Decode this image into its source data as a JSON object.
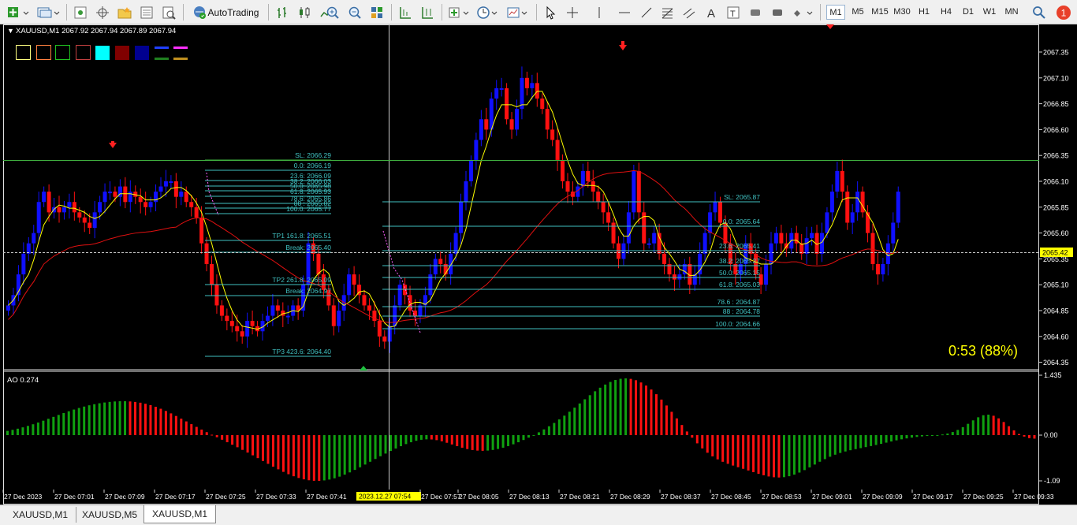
{
  "toolbar": {
    "autotrading_label": "AutoTrading",
    "timeframes": [
      "M1",
      "M5",
      "M15",
      "M30",
      "H1",
      "H4",
      "D1",
      "W1",
      "MN"
    ],
    "active_timeframe": "M1",
    "notification_count": "1"
  },
  "chart": {
    "header": "XAUUSD,M1  2067.92 2067.94 2067.89 2067.94",
    "current_price": "2065.42",
    "timer_text": "0:53 (88%)",
    "indicator_label": "AO 0.274",
    "ao_axis": [
      "1.435",
      "0.00",
      "-1.09"
    ],
    "price_ticks": [
      "2067.35",
      "2067.10",
      "2066.85",
      "2066.60",
      "2066.35",
      "2066.10",
      "2065.85",
      "2065.60",
      "2065.35",
      "2065.10",
      "2064.85",
      "2064.60",
      "2064.35"
    ],
    "time_labels": [
      "27 Dec 2023",
      "27 Dec 07:01",
      "27 Dec 07:09",
      "27 Dec 07:17",
      "27 Dec 07:25",
      "27 Dec 07:33",
      "27 Dec 07:41",
      "2023.12.27 07:54",
      "27 Dec 07:57",
      "27 Dec 08:05",
      "27 Dec 08:13",
      "27 Dec 08:21",
      "27 Dec 08:29",
      "27 Dec 08:37",
      "27 Dec 08:45",
      "27 Dec 08:53",
      "27 Dec 09:01",
      "27 Dec 09:09",
      "27 Dec 09:17",
      "27 Dec 09:25",
      "27 Dec 09:33"
    ],
    "fib_left": [
      "SL: 2066.29",
      "0.0: 2066.19",
      "23.6: 2066.09",
      "38.2: 2066.03",
      "50.0: 2065.98",
      "61.8: 2065.93",
      "78.6: 2065.86",
      "88 : 2065.82",
      "100.0: 2065.77",
      "TP1 161.8: 2065.51",
      "Break: 2065.40",
      "TP2 261.8: 2065.09",
      "Break: 2064.97",
      "TP3 423.6: 2064.40"
    ],
    "fib_right": [
      "SL: 2065.87",
      "0.0: 2065.64",
      "23.6: 2065.41",
      "38.2: 2065.27",
      "50.0: 2065.15",
      "61.8: 2065.03",
      "78.6 : 2064.87",
      "88 : 2064.78",
      "100.0: 2064.66"
    ],
    "colors": {
      "bull": "#1010ff",
      "bear": "#ff1010",
      "fast_ma": "#ffff00",
      "slow_ma": "#e01010",
      "fib": "#40c0c0",
      "ao_up": "#10a010",
      "ao_down": "#ff1010",
      "sl_line": "#40b040"
    }
  },
  "tabs": [
    "XAUUSD,M1",
    "XAUUSD,M5",
    "XAUUSD,M1"
  ],
  "active_tab": 2
}
